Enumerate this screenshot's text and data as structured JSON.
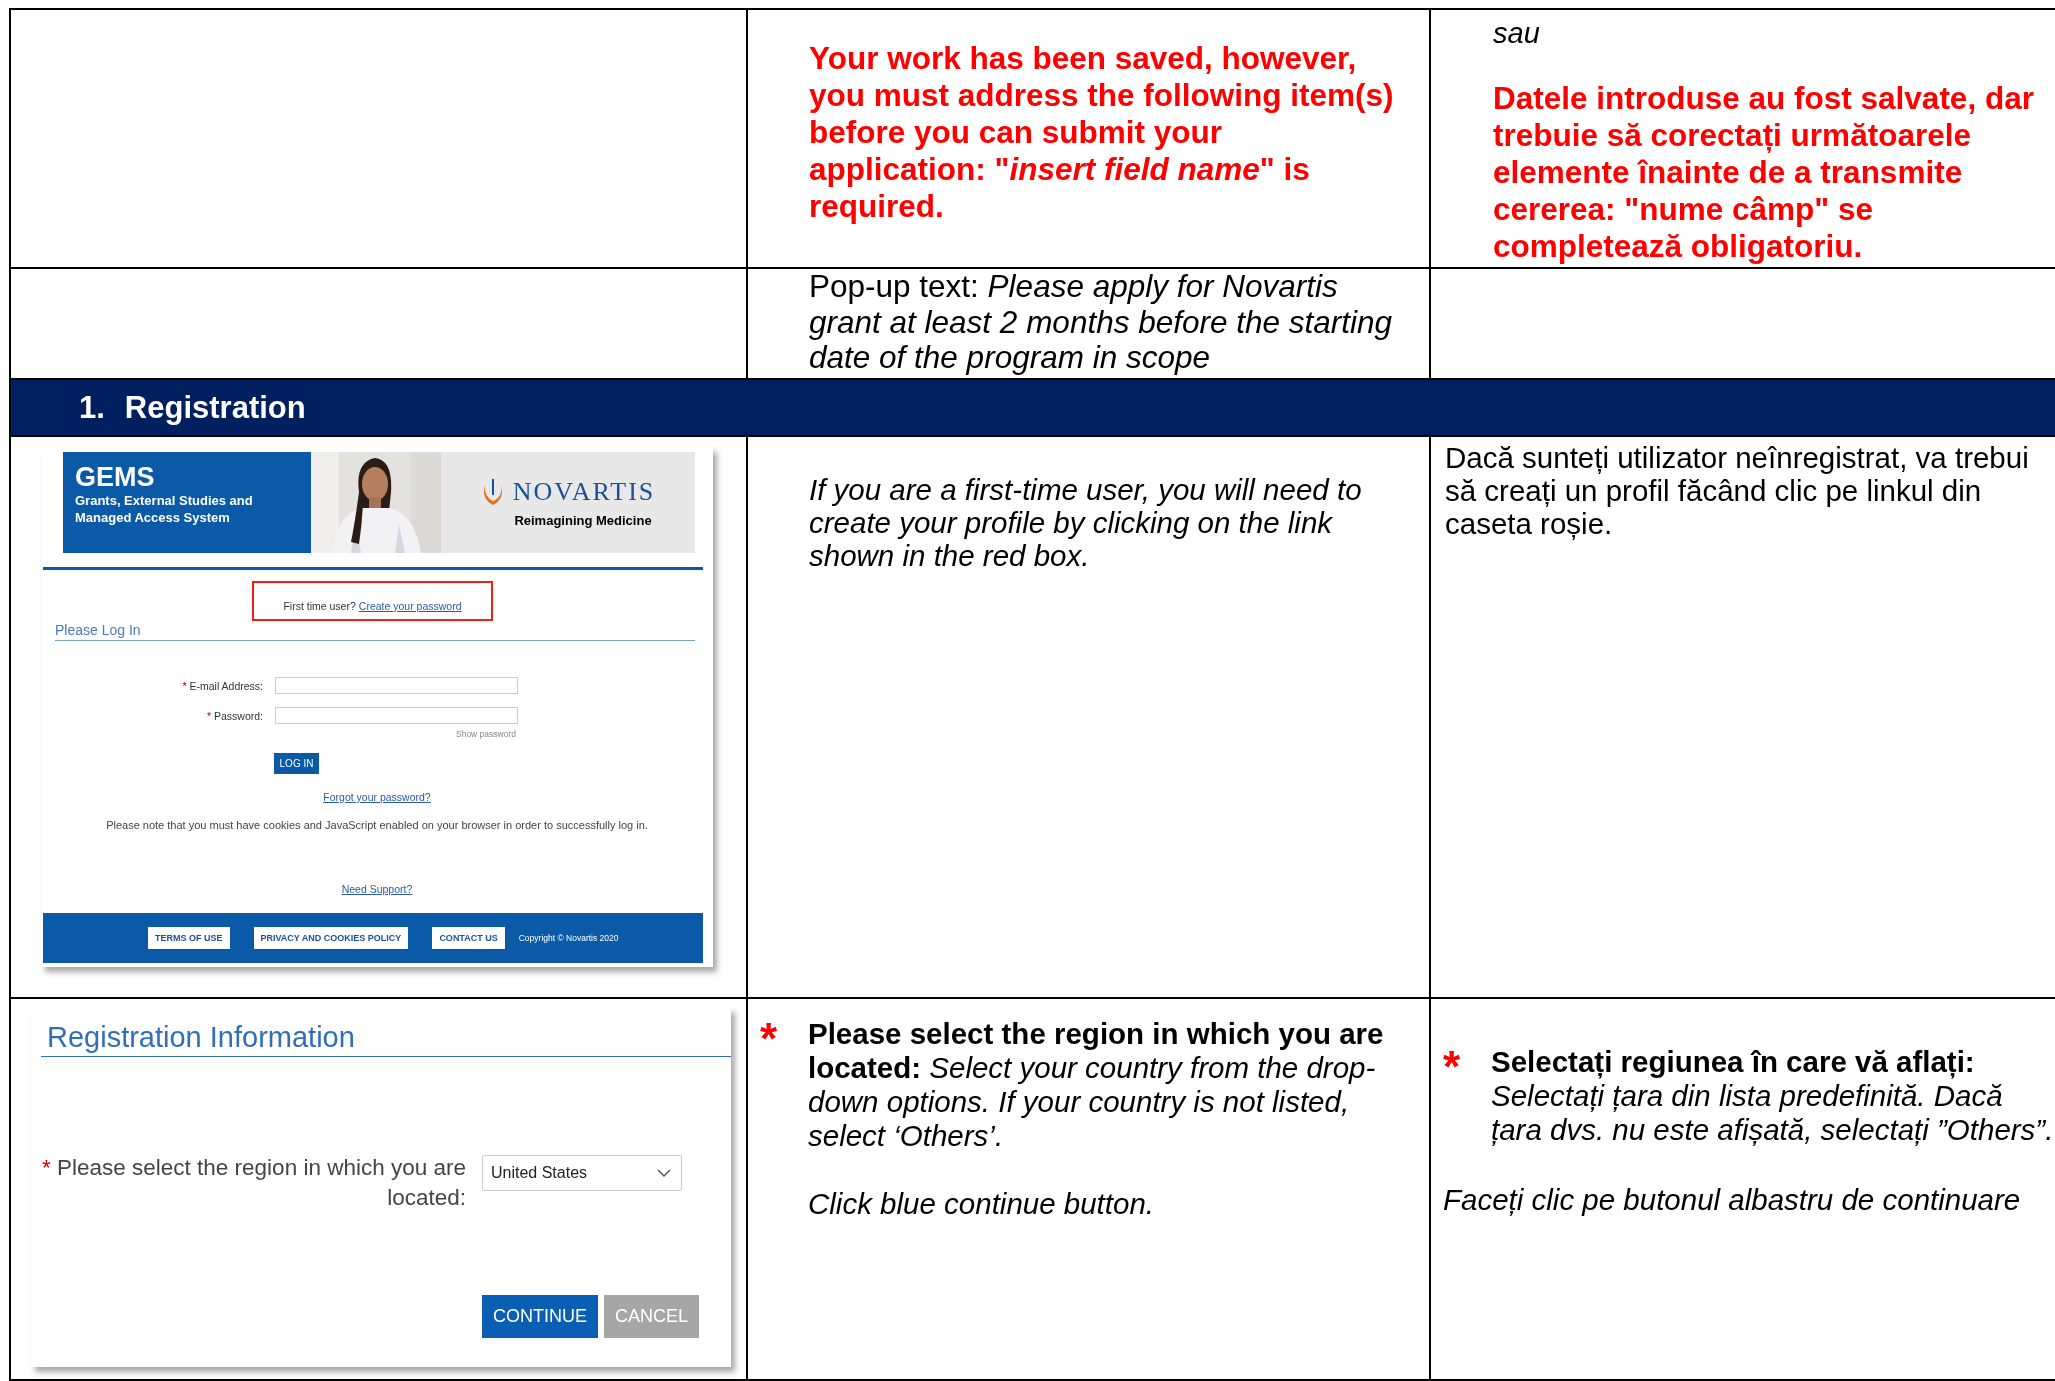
{
  "error_row": {
    "english": "Your work has been saved, however, you must address the following item(s) before you can submit your application: \"*insert field name*\" is required.",
    "romanian_connector": "sau",
    "romanian": "Datele introduse au fost salvate, dar trebuie să corectați următoarele elemente înainte de a transmite cererea: \"nume câmp\" se completează obligatoriu."
  },
  "popup_row": {
    "english": "Pop-up text: *Please apply for Novartis grant at least 2 months before the starting date of the program in scope*"
  },
  "section_header": {
    "number": "1.",
    "title": "Registration"
  },
  "login_row": {
    "screen": {
      "banner": {
        "title": "GEMS",
        "subtitle": "Grants, External Studies and Managed Access System",
        "brand": "NOVARTIS",
        "tagline": "Reimagining Medicine"
      },
      "first_time_prompt": "First time user?",
      "create_link": "Create your password",
      "heading": "Please Log In",
      "fields": [
        {
          "label": "E-mail Address:",
          "required": true
        },
        {
          "label": "Password:",
          "required": true
        }
      ],
      "show_password": "Show password",
      "login_button": "LOG IN",
      "forgot_link": "Forgot your password?",
      "note": "Please note that you must have cookies and JavaScript enabled on your browser in order to successfully log in.",
      "support_link": "Need Support?",
      "footer_buttons": [
        "TERMS OF USE",
        "PRIVACY AND COOKIES POLICY",
        "CONTACT US"
      ],
      "copyright": "Copyright © Novartis 2020"
    },
    "english": "If you are a first-time user, you will need to create your profile by clicking on the link shown in the red box.",
    "romanian": "Dacă sunteți utilizator neînregistrat, va trebui să creați un profil făcând clic pe linkul din caseta roșie."
  },
  "region_row": {
    "screen": {
      "heading": "Registration Information",
      "field": {
        "label": "Please select the region in which you are located:",
        "required": true,
        "value": "United States"
      },
      "buttons": [
        {
          "label": "CONTINUE",
          "kind": "primary"
        },
        {
          "label": "CANCEL",
          "kind": "secondary"
        }
      ]
    },
    "english": {
      "mark": "*",
      "instruction": "**Please select the region in which you are located:** *Select your country from the drop-down options. If your country is not listed, select ‘Others’.*",
      "action": "Click blue continue button."
    },
    "romanian": {
      "mark": "*",
      "instruction": "**Selectați regiunea în care vă aflați:** *Selectați țara din lista predefinită. Dacă țara dvs. nu este afișată, selectați ”Others”.*",
      "action": "Faceți clic pe butonul albastru de continuare"
    }
  }
}
